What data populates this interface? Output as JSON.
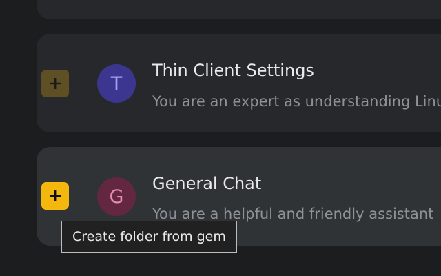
{
  "gems": [
    {
      "avatar_letter": "T",
      "title": "Thin Client Settings",
      "description": "You are an expert as understanding Linux thin client settings"
    },
    {
      "avatar_letter": "G",
      "title": "General Chat",
      "description": "You are a helpful and friendly assistant"
    }
  ],
  "tooltip": {
    "text": "Create folder from gem"
  },
  "icons": {
    "folder_add": "plus-icon"
  },
  "colors": {
    "folder_button_active": "#f4b70e",
    "folder_button_dim": "#5e4f25",
    "avatar_t_bg": "#3d3690",
    "avatar_g_bg": "#632741"
  }
}
